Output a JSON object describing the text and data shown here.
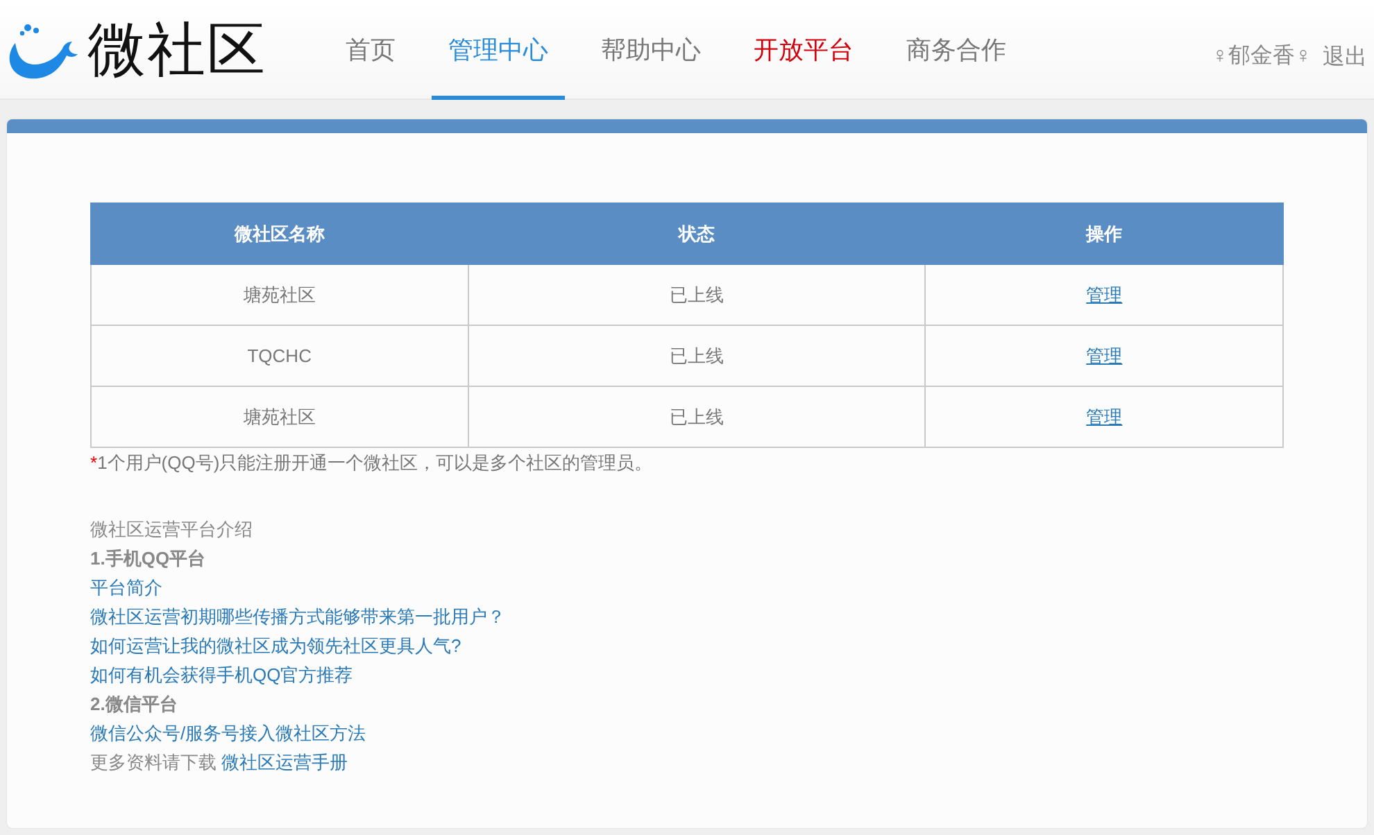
{
  "header": {
    "logo_text": "微社区",
    "nav": [
      {
        "label": "首页",
        "selected": false,
        "kind": "normal"
      },
      {
        "label": "管理中心",
        "selected": true,
        "kind": "normal"
      },
      {
        "label": "帮助中心",
        "selected": false,
        "kind": "normal"
      },
      {
        "label": "开放平台",
        "selected": false,
        "kind": "featured"
      },
      {
        "label": "商务合作",
        "selected": false,
        "kind": "normal"
      }
    ],
    "user": "♀郁金香♀",
    "logout": "退出"
  },
  "table": {
    "columns": [
      "微社区名称",
      "状态",
      "操作"
    ],
    "rows": [
      {
        "name": "塘苑社区",
        "status": "已上线",
        "action": "管理"
      },
      {
        "name": "TQCHC",
        "status": "已上线",
        "action": "管理"
      },
      {
        "name": "塘苑社区",
        "status": "已上线",
        "action": "管理"
      }
    ]
  },
  "note": {
    "mark": "*",
    "text": "1个用户(QQ号)只能注册开通一个微社区，可以是多个社区的管理员。"
  },
  "guide": [
    {
      "kind": "intro",
      "text": "微社区运营平台介绍"
    },
    {
      "kind": "heading",
      "text": "1.手机QQ平台"
    },
    {
      "kind": "link",
      "text": "平台简介"
    },
    {
      "kind": "link",
      "text": "微社区运营初期哪些传播方式能够带来第一批用户？"
    },
    {
      "kind": "link",
      "text": "如何运营让我的微社区成为领先社区更具人气?"
    },
    {
      "kind": "link",
      "text": "如何有机会获得手机QQ官方推荐"
    },
    {
      "kind": "heading",
      "text": "2.微信平台"
    },
    {
      "kind": "link",
      "text": "微信公众号/服务号接入微社区方法"
    },
    {
      "kind": "download",
      "text": "更多资料请下载",
      "link": "微社区运营手册"
    }
  ]
}
